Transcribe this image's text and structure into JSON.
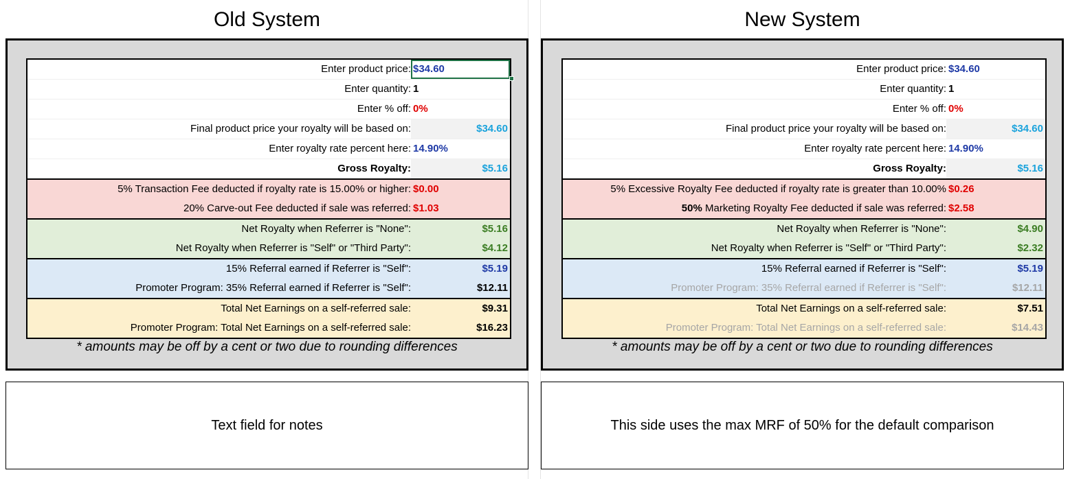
{
  "left": {
    "title": "Old System",
    "rows": [
      {
        "label": "Enter product price:",
        "value": "$34.60"
      },
      {
        "label": "Enter quantity:",
        "value": "1"
      },
      {
        "label": "Enter % off:",
        "value": "0%"
      },
      {
        "label": "Final product price your royalty will be based on:",
        "value": "$34.60"
      },
      {
        "label": "Enter royalty rate percent here:",
        "value": "14.90%"
      },
      {
        "label": "Gross Royalty:",
        "value": "$5.16"
      },
      {
        "label": "5% Transaction Fee deducted if royalty rate is 15.00% or higher:",
        "value": "$0.00"
      },
      {
        "label": "20% Carve-out Fee deducted if sale was referred:",
        "value": "$1.03"
      },
      {
        "label": "Net Royalty when Referrer is \"None\":",
        "value": "$5.16"
      },
      {
        "label": "Net Royalty when Referrer is \"Self\" or \"Third Party\":",
        "value": "$4.12"
      },
      {
        "label": "15% Referral earned if Referrer is \"Self\":",
        "value": "$5.19"
      },
      {
        "label": "Promoter Program: 35% Referral earned if Referrer is \"Self\":",
        "value": "$12.11"
      },
      {
        "label": "Total Net Earnings on a self-referred sale:",
        "value": "$9.31"
      },
      {
        "label": "Promoter Program: Total Net Earnings on a self-referred sale:",
        "value": "$16.23"
      }
    ],
    "footnote": "* amounts may be off by a cent or two due to rounding differences",
    "notes": "Text field for notes"
  },
  "right": {
    "title": "New System",
    "rows": [
      {
        "label": "Enter product price:",
        "value": "$34.60"
      },
      {
        "label": "Enter quantity:",
        "value": "1"
      },
      {
        "label": "Enter % off:",
        "value": "0%"
      },
      {
        "label": "Final product price your royalty will be based on:",
        "value": "$34.60"
      },
      {
        "label": "Enter royalty rate percent here:",
        "value": "14.90%"
      },
      {
        "label": "Gross Royalty:",
        "value": "$5.16"
      },
      {
        "label": "5% Excessive Royalty Fee deducted if royalty rate is greater than 10.00%",
        "value": "$0.26"
      },
      {
        "label_bold": "50%",
        "label": " Marketing Royalty Fee deducted if sale was referred:",
        "value": "$2.58"
      },
      {
        "label": "Net Royalty when Referrer is \"None\":",
        "value": "$4.90"
      },
      {
        "label": "Net Royalty when Referrer is \"Self\" or \"Third Party\":",
        "value": "$2.32"
      },
      {
        "label": "15% Referral earned if Referrer is \"Self\":",
        "value": "$5.19"
      },
      {
        "label": "Promoter Program: 35% Referral earned if Referrer is \"Self\":",
        "value": "$12.11"
      },
      {
        "label": "Total Net Earnings on a self-referred sale:",
        "value": "$7.51"
      },
      {
        "label": "Promoter Program: Total Net Earnings on a self-referred sale:",
        "value": "$14.43"
      }
    ],
    "footnote": "* amounts may be off by a cent or two due to rounding differences",
    "notes": "This side uses the max MRF of 50% for the default comparison"
  },
  "colors": {
    "outer_panel": "#d9d9d9",
    "fee_rows": "#f9d7d5",
    "net_rows": "#e1eed9",
    "referral_rows": "#dce9f6",
    "total_rows": "#fdf0cd",
    "input_blue": "#1f3aa6",
    "computed_cyan": "#1ba3dc",
    "fee_red": "#e00000",
    "net_green": "#3b7d23",
    "disabled_grey": "#a6a6a6",
    "selection_green": "#1e7145"
  }
}
